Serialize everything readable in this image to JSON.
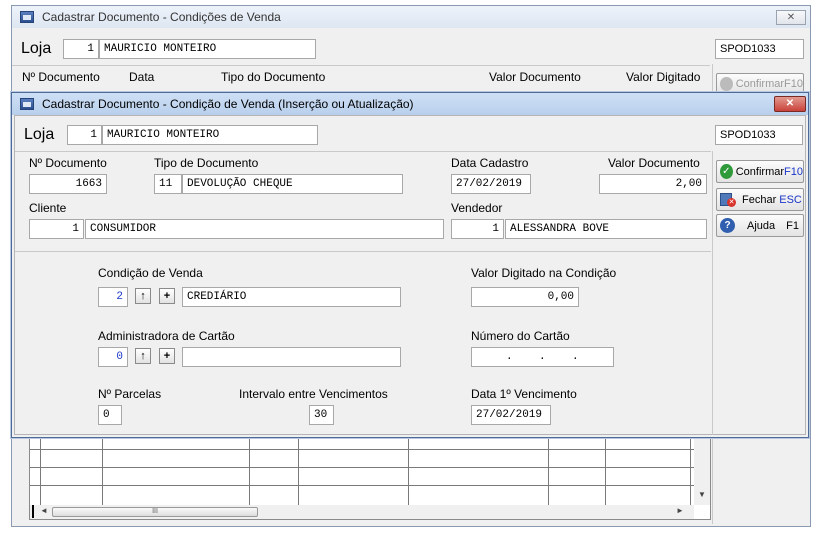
{
  "outer": {
    "title": "Cadastrar Documento - Condições de Venda",
    "close": "✕",
    "loja_label": "Loja",
    "loja_num": "1",
    "loja_name": "MAURICIO MONTEIRO",
    "code": "SPOD1033",
    "columns": [
      "Nº Documento",
      "Data",
      "Tipo do Documento",
      "Valor Documento",
      "Valor Digitado"
    ],
    "confirm_label": "Confirmar",
    "confirm_key": "F10",
    "scroll_thumb": "III"
  },
  "dialog": {
    "title": "Cadastrar Documento - Condição de Venda (Inserção ou Atualização)",
    "close": "✕",
    "loja_label": "Loja",
    "loja_num": "1",
    "loja_name": "MAURICIO MONTEIRO",
    "code": "SPOD1033",
    "num_doc_label": "Nº Documento",
    "num_doc": "1663",
    "tipo_label": "Tipo de Documento",
    "tipo_code": "11",
    "tipo_name": "DEVOLUÇÃO CHEQUE",
    "data_cad_label": "Data Cadastro",
    "data_cad": "27/02/2019",
    "valor_doc_label": "Valor Documento",
    "valor_doc": "2,00",
    "cliente_label": "Cliente",
    "cliente_num": "1",
    "cliente_name": "CONSUMIDOR",
    "vendedor_label": "Vendedor",
    "vendedor_num": "1",
    "vendedor_name": "ALESSANDRA BOVE",
    "cond_label": "Condição de Venda",
    "cond_num": "2",
    "cond_name": "CREDIÁRIO",
    "valor_dig_label": "Valor Digitado na Condição",
    "valor_dig": "0,00",
    "admin_label": "Administradora de Cartão",
    "admin_num": "0",
    "admin_name": "",
    "num_cartao_label": "Número do Cartão",
    "num_cartao": ".    .    .",
    "parcelas_label": "Nº Parcelas",
    "parcelas": "0",
    "intervalo_label": "Intervalo entre Vencimentos",
    "intervalo": "30",
    "data_venc_label": "Data 1º Vencimento",
    "data_venc": "27/02/2019",
    "arrow_up": "↑",
    "plus": "+",
    "buttons": {
      "confirm": {
        "label": "Confirmar",
        "key": "F10"
      },
      "close": {
        "label": "Fechar",
        "key": "ESC"
      },
      "help": {
        "label": "Ajuda",
        "key": "F1"
      }
    }
  },
  "colors": {
    "accent_blue": "#1a36c8",
    "close_red": "#c9423a",
    "confirm_green": "#2e9a3a"
  }
}
